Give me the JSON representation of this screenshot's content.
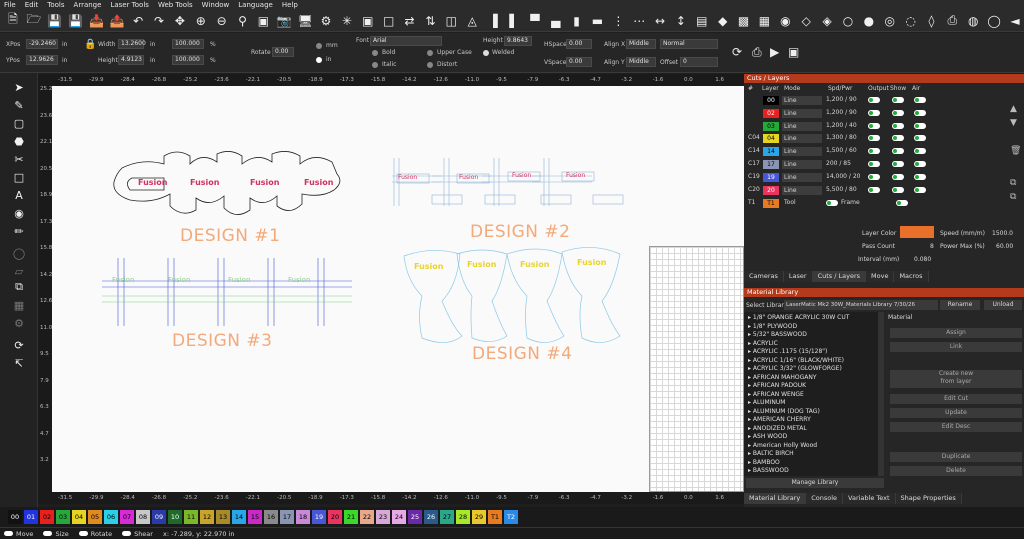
{
  "menu": [
    "File",
    "Edit",
    "Tools",
    "Arrange",
    "Laser Tools",
    "Web Tools",
    "Window",
    "Language",
    "Help"
  ],
  "toolbar_icons": [
    "new-file",
    "open-folder",
    "save",
    "save-as",
    "import",
    "export",
    "undo",
    "redo",
    "zoom-in",
    "zoom-out",
    "zoom-frame",
    "select-rect",
    "camera",
    "monitor",
    "settings",
    "tools",
    "rotary",
    "trace",
    "mirror-h",
    "mirror-v",
    "group",
    "ungroup",
    "align-left",
    "align-right",
    "align-top",
    "align-bottom",
    "align-center-h",
    "align-center-v",
    "distribute-h",
    "distribute-v",
    "size-w",
    "size-h",
    "dock"
  ],
  "props": {
    "xpos_label": "XPos",
    "xpos": "-29.2460",
    "xpos_unit": "in",
    "ypos_label": "YPos",
    "ypos": "12.9626",
    "ypos_unit": "in",
    "width_label": "Width",
    "width": "13.2600",
    "width_unit": "in",
    "height_label": "Height",
    "height": "4.9123",
    "height_unit": "in",
    "scale_w": "100.000",
    "scale_h": "100.000",
    "pct": "%",
    "rotate_label": "Rotate",
    "rotate": "0.00",
    "unit_mm": "mm",
    "unit_in": "in",
    "font_label": "Font",
    "font": "Arial",
    "font_height_label": "Height",
    "font_height": "9.8643",
    "bold": "Bold",
    "italic": "Italic",
    "upper_case": "Upper Case",
    "distort": "Distort",
    "welded": "Welded",
    "hspace_label": "HSpace",
    "hspace": "0.00",
    "vspace_label": "VSpace",
    "vspace": "0.00",
    "alignx_label": "Align X",
    "alignx": "Middle",
    "aligny_label": "Align Y",
    "aligny": "Middle",
    "normal": "Normal",
    "offset_label": "Offset",
    "offset": "0"
  },
  "ruler_x": [
    "-31.5",
    "-29.9",
    "-28.4",
    "-26.8",
    "-25.2",
    "-23.6",
    "-22.1",
    "-20.5",
    "-18.9",
    "-17.3",
    "-15.8",
    "-14.2",
    "-12.6",
    "-11.0",
    "-9.5",
    "-7.9",
    "-6.3",
    "-4.7",
    "-3.2",
    "-1.6",
    "0.0",
    "1.6",
    "3.2"
  ],
  "ruler_y": [
    "25.2",
    "23.6",
    "22.1",
    "20.5",
    "18.9",
    "17.3",
    "15.8",
    "14.2",
    "12.6",
    "11.0",
    "9.5",
    "7.9",
    "6.3",
    "4.7",
    "3.2"
  ],
  "canvas": {
    "design_labels": [
      "DESIGN #1",
      "DESIGN #2",
      "DESIGN #3",
      "DESIGN #4"
    ],
    "word": "Fusion"
  },
  "cuts_layers": {
    "title": "Cuts / Layers",
    "headers": [
      "#",
      "Layer",
      "Mode",
      "Spd/Pwr",
      "Output",
      "Show",
      "Air"
    ],
    "rows": [
      {
        "num": "",
        "layer": "00",
        "color": "#000000",
        "text_color": "#ffffff",
        "mode": "Line",
        "spd": "1,200 / 90"
      },
      {
        "num": "",
        "layer": "02",
        "color": "#e8211f",
        "text_color": "#ffffff",
        "mode": "Line",
        "spd": "1,200 / 90"
      },
      {
        "num": "",
        "layer": "03",
        "color": "#26a83b",
        "text_color": "#000000",
        "mode": "Line",
        "spd": "1,200 / 40"
      },
      {
        "num": "C04",
        "layer": "04",
        "color": "#e6d422",
        "text_color": "#000000",
        "mode": "Line",
        "spd": "1,300 / 80"
      },
      {
        "num": "C14",
        "layer": "14",
        "color": "#2aa6e8",
        "text_color": "#000000",
        "mode": "Line",
        "spd": "1,500 / 60"
      },
      {
        "num": "C17",
        "layer": "17",
        "color": "#8a95b4",
        "text_color": "#000000",
        "mode": "Line",
        "spd": "200 / 85"
      },
      {
        "num": "C19",
        "layer": "19",
        "color": "#4757d6",
        "text_color": "#ffffff",
        "mode": "Line",
        "spd": "14,000 / 20"
      },
      {
        "num": "C20",
        "layer": "20",
        "color": "#e8345e",
        "text_color": "#ffffff",
        "mode": "Line",
        "spd": "5,500 / 80"
      }
    ],
    "tool_row": {
      "num": "T1",
      "layer": "T1",
      "mode": "Tool",
      "frame": "Frame"
    },
    "layer_color_label": "Layer Color",
    "speed_label": "Speed (mm/m)",
    "speed": "1500.0",
    "pass_count_label": "Pass Count",
    "pass_count": "8",
    "power_max_label": "Power Max (%)",
    "power_max": "60.00",
    "interval_label": "Interval (mm)",
    "interval": "0.080",
    "tabs": [
      "Cameras",
      "Laser",
      "Cuts / Layers",
      "Move",
      "Macros"
    ]
  },
  "material_library": {
    "title": "Material Library",
    "select_label": "Select Library",
    "library": "LaserMatic Mk2 30W_Materials Library 7/30/26",
    "rename": "Rename",
    "unload": "Unload",
    "material_label": "Material",
    "items": [
      "1/8\" ORANGE ACRYLIC 30W CUT",
      "1/8\" PLYWOOD",
      "5/32\" BASSWOOD",
      "ACRYLIC",
      "ACRYLIC .1175 (15/128\")",
      "ACRYLIC 1/16\" (BLACK/WHITE)",
      "ACRYLIC 3/32\" (GLOWFORGE)",
      "AFRICAN MAHOGANY",
      "AFRICAN PADOUK",
      "AFRICAN WENGE",
      "ALUMINUM",
      "ALUMINUM (DOG TAG)",
      "AMERICAN CHERRY",
      "ANODIZED METAL",
      "ASH WOOD",
      "American Holly Wood",
      "BALTIC BIRCH",
      "BAMBOO",
      "BASSWOOD"
    ],
    "buttons": [
      "Assign",
      "Link",
      "Create new\nfrom layer",
      "Edit Cut",
      "Update",
      "Edit Desc",
      "Duplicate",
      "Delete"
    ],
    "manage": "Manage Library",
    "tabs": [
      "Material Library",
      "Console",
      "Variable Text",
      "Shape Properties"
    ]
  },
  "palette": [
    {
      "label": "00",
      "color": "#111111",
      "fg": "#ffffff"
    },
    {
      "label": "01",
      "color": "#2233e0",
      "fg": "#ffffff"
    },
    {
      "label": "02",
      "color": "#e8211f",
      "fg": "#000000"
    },
    {
      "label": "03",
      "color": "#26a83b",
      "fg": "#000000"
    },
    {
      "label": "04",
      "color": "#e6d422",
      "fg": "#000000"
    },
    {
      "label": "05",
      "color": "#e08a1f",
      "fg": "#000000"
    },
    {
      "label": "06",
      "color": "#2ad0e8",
      "fg": "#000000"
    },
    {
      "label": "07",
      "color": "#d82ad8",
      "fg": "#000000"
    },
    {
      "label": "08",
      "color": "#c8c8c8",
      "fg": "#000000"
    },
    {
      "label": "09",
      "color": "#2a3aa8",
      "fg": "#ffffff"
    },
    {
      "label": "10",
      "color": "#1e6a2a",
      "fg": "#ffffff"
    },
    {
      "label": "11",
      "color": "#7ab82a",
      "fg": "#000000"
    },
    {
      "label": "12",
      "color": "#c8a42a",
      "fg": "#000000"
    },
    {
      "label": "13",
      "color": "#a88a2a",
      "fg": "#000000"
    },
    {
      "label": "14",
      "color": "#2aa6e8",
      "fg": "#000000"
    },
    {
      "label": "15",
      "color": "#c82ac8",
      "fg": "#000000"
    },
    {
      "label": "16",
      "color": "#8a8a8a",
      "fg": "#000000"
    },
    {
      "label": "17",
      "color": "#8a95b4",
      "fg": "#000000"
    },
    {
      "label": "18",
      "color": "#c88ad8",
      "fg": "#000000"
    },
    {
      "label": "19",
      "color": "#4757d6",
      "fg": "#ffffff"
    },
    {
      "label": "20",
      "color": "#e8345e",
      "fg": "#000000"
    },
    {
      "label": "21",
      "color": "#3ad82a",
      "fg": "#000000"
    },
    {
      "label": "22",
      "color": "#e8a88a",
      "fg": "#000000"
    },
    {
      "label": "23",
      "color": "#d8a8d8",
      "fg": "#000000"
    },
    {
      "label": "24",
      "color": "#e8a8e8",
      "fg": "#000000"
    },
    {
      "label": "25",
      "color": "#6a2aa8",
      "fg": "#ffffff"
    },
    {
      "label": "26",
      "color": "#2a5a8a",
      "fg": "#ffffff"
    },
    {
      "label": "27",
      "color": "#2aa88a",
      "fg": "#000000"
    },
    {
      "label": "28",
      "color": "#a8e82a",
      "fg": "#000000"
    },
    {
      "label": "29",
      "color": "#e8c82a",
      "fg": "#000000"
    },
    {
      "label": "T1",
      "color": "#e87a1f",
      "fg": "#000000"
    },
    {
      "label": "T2",
      "color": "#2a8ae8",
      "fg": "#ffffff"
    }
  ],
  "status": {
    "move": "Move",
    "size": "Size",
    "rotate": "Rotate",
    "shear": "Shear",
    "coords": "x: -7.289, y: 22.970 in"
  }
}
